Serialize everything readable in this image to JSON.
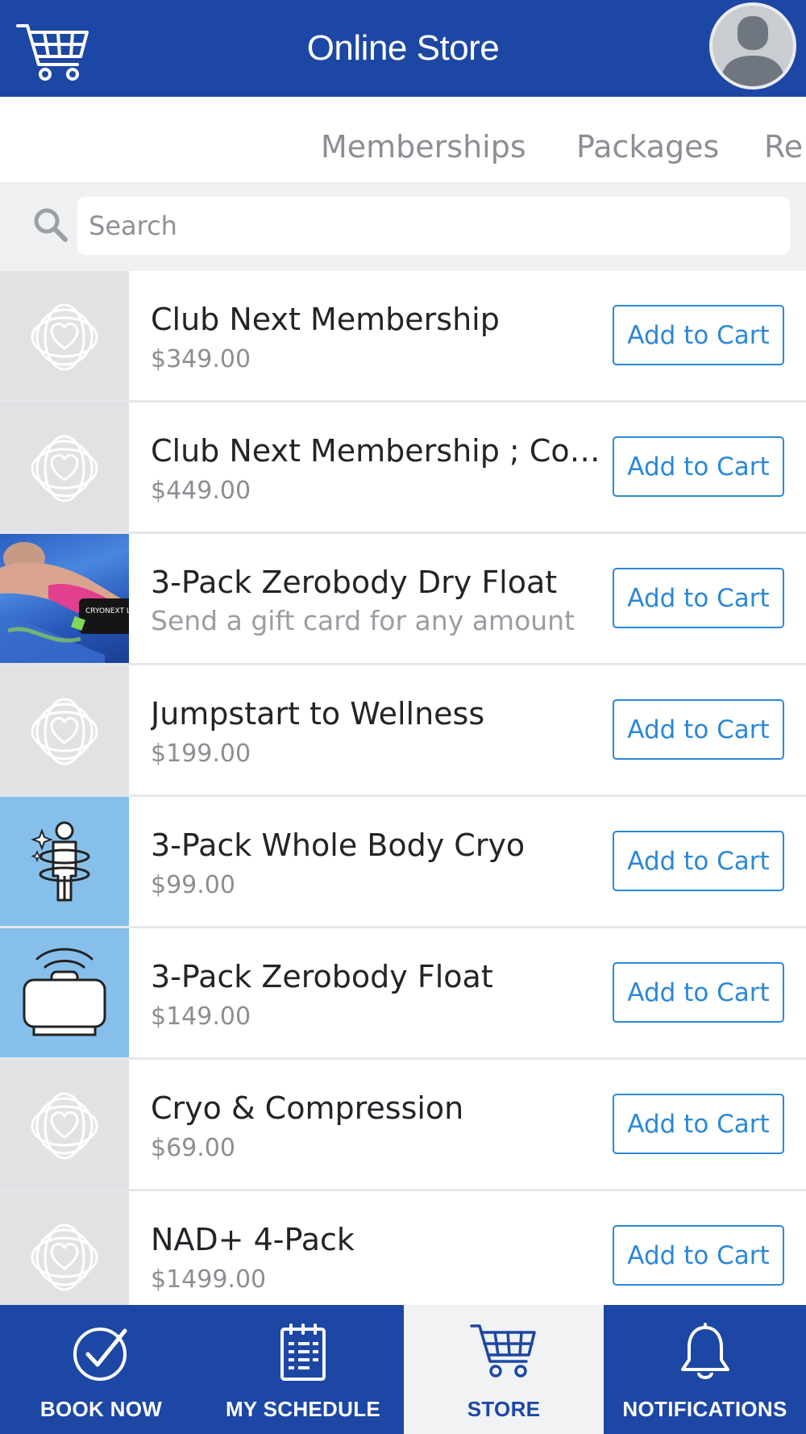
{
  "header": {
    "title": "Online Store",
    "cart_icon": "cart-icon",
    "avatar_icon": "user-avatar-icon",
    "background": "#1d47a4"
  },
  "tabs": [
    {
      "label": "Memberships"
    },
    {
      "label": "Packages"
    },
    {
      "label": "Re"
    }
  ],
  "search": {
    "placeholder": "Search",
    "value": "",
    "icon": "search-icon"
  },
  "products": [
    {
      "name": "Club Next Membership",
      "subtitle": "$349.00",
      "thumb": "flower-logo",
      "button": "Add to Cart"
    },
    {
      "name": "Club Next Membership ; Cou...",
      "subtitle": "$449.00",
      "thumb": "flower-logo",
      "button": "Add to Cart"
    },
    {
      "name": "3-Pack Zerobody Dry Float",
      "subtitle": "Send a gift card for any amount",
      "thumb": "float-photo",
      "thumb_text": "CRYONEXT LABS",
      "button": "Add to Cart"
    },
    {
      "name": "Jumpstart to Wellness",
      "subtitle": "$199.00",
      "thumb": "flower-logo",
      "button": "Add to Cart"
    },
    {
      "name": "3-Pack Whole Body Cryo",
      "subtitle": "$99.00",
      "thumb": "cryo-body-icon",
      "button": "Add to Cart"
    },
    {
      "name": "3-Pack Zerobody Float",
      "subtitle": "$149.00",
      "thumb": "float-bed-icon",
      "button": "Add to Cart"
    },
    {
      "name": "Cryo & Compression",
      "subtitle": "$69.00",
      "thumb": "flower-logo",
      "button": "Add to Cart"
    },
    {
      "name": "NAD+ 4-Pack",
      "subtitle": "$1499.00",
      "thumb": "flower-logo",
      "button": "Add to Cart"
    }
  ],
  "bottom_nav": [
    {
      "label": "BOOK NOW",
      "icon": "check-circle-icon",
      "active": false
    },
    {
      "label": "MY SCHEDULE",
      "icon": "calendar-icon",
      "active": false
    },
    {
      "label": "STORE",
      "icon": "cart-icon",
      "active": true
    },
    {
      "label": "NOTIFICATIONS",
      "icon": "bell-icon",
      "active": false
    }
  ],
  "colors": {
    "primary": "#1d47a4",
    "accent": "#2b88d8",
    "thumb_gray": "#e1e2e4",
    "thumb_blue": "#86c0ea"
  }
}
